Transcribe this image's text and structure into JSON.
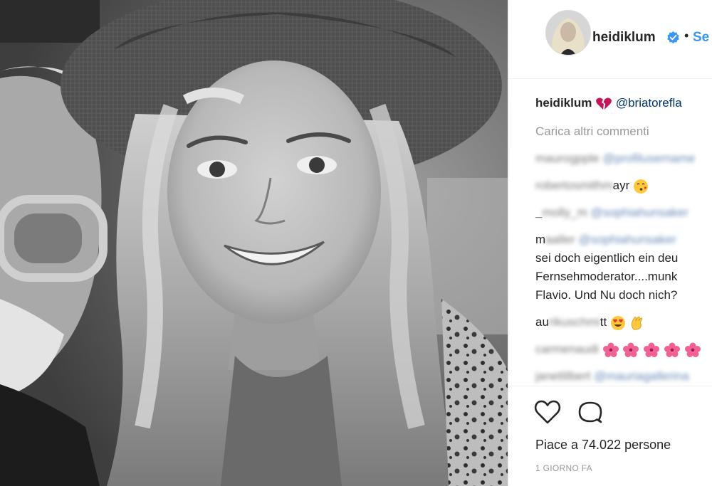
{
  "post": {
    "username": "heidiklum",
    "follow_label": "Se",
    "bullet": "•"
  },
  "caption": {
    "username": "heidiklum",
    "mention": "@briatorefla"
  },
  "comments_link": "Carica altri commenti",
  "comments": [
    {
      "user_blurred": "maurogpple",
      "text_blurred": "@profilusername"
    },
    {
      "user_blurred": "robertosmithm",
      "visible_text": "ayr"
    },
    {
      "prefix": "_",
      "user_blurred": "molly_m",
      "text_blurred": "@sophiahunsaker"
    },
    {
      "prefix": "m",
      "user_blurred": "aaller",
      "text_blurred": "@sophiahunsaker"
    },
    {
      "lines": [
        "sei doch eigentlich ein deu",
        "Fernsehmoderator....munk",
        "Flavio. Und Nu doch nich?"
      ]
    },
    {
      "prefix": "au",
      "user_blurred": "rikuschmi",
      "visible_text": "tt"
    },
    {
      "user_blurred": "carmenaudi"
    },
    {
      "user_blurred": "janetlilbert",
      "text_blurred": "@mauriagallerina"
    }
  ],
  "likes_text": "Piace a 74.022 persone",
  "timestamp": "1 GIORNO FA",
  "icons": {
    "verified": "verified-badge-icon",
    "like": "heart-outline-icon",
    "comment": "comment-bubble-icon",
    "caption_emoji": "broken-heart-emoji",
    "kiss_emoji": "kissing-face-emoji",
    "heart_eyes_emoji": "heart-eyes-emoji",
    "clap_emoji": "clapping-hands-emoji",
    "flower_emoji": "hibiscus-emoji"
  },
  "colors": {
    "link_blue": "#3897f0",
    "mention": "#003569",
    "muted": "#999999",
    "verified": "#3897f0",
    "caption_emoji": "#c2185b"
  }
}
